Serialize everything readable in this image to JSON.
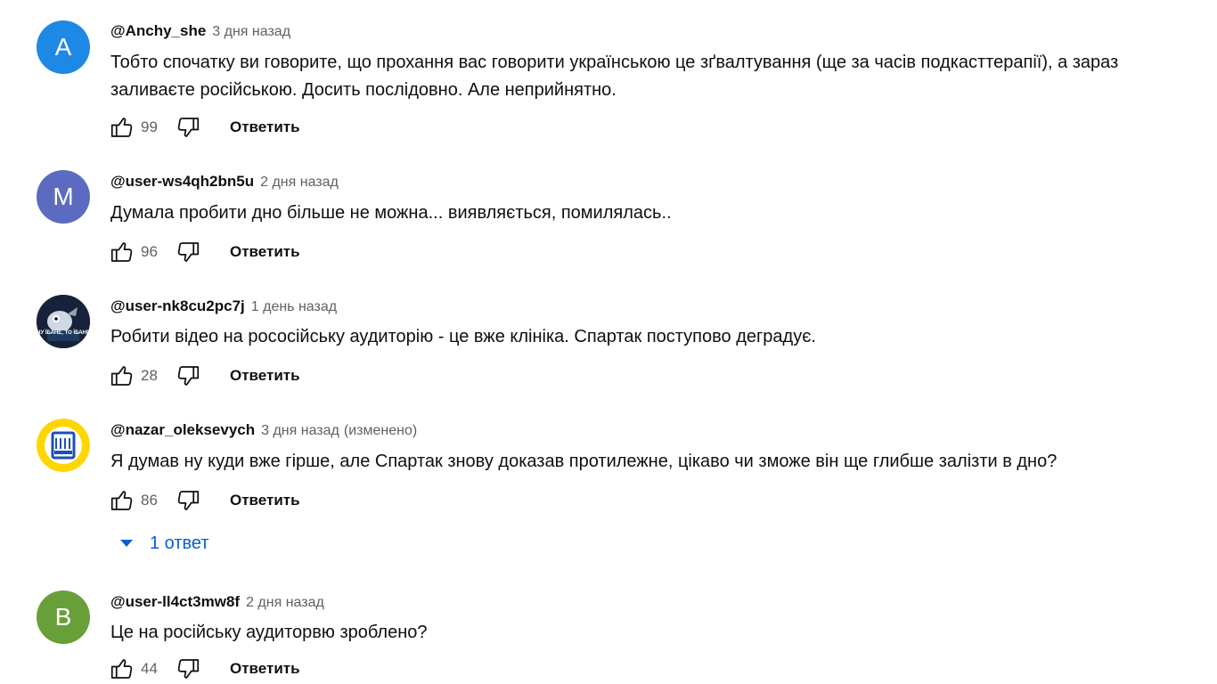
{
  "comments": [
    {
      "author": "@Anchy_she",
      "time": "3 дня назад",
      "edited": "",
      "avatar_letter": "A",
      "avatar_color": "#1e88e5",
      "text": "Тобто спочатку ви говорите, що прохання вас говорити українською це зґвалтування (ще за часів подкасттерапії), а зараз заливаєте російською. Досить послідовно. Але неприйнятно.",
      "likes": "99",
      "reply_label": "Ответить"
    },
    {
      "author": "@user-ws4qh2bn5u",
      "time": "2 дня назад",
      "edited": "",
      "avatar_letter": "M",
      "avatar_color": "#5c6bc0",
      "text": "Думала пробити дно більше не можна... виявляється, помилялась..",
      "likes": "96",
      "reply_label": "Ответить"
    },
    {
      "author": "@user-nk8cu2pc7j",
      "time": "1 день назад",
      "edited": "",
      "avatar_caption": "ну їбане, то їбане",
      "text": "Робити відео на рососійську аудиторію - це вже клініка. Спартак поступово деградує.",
      "likes": "28",
      "reply_label": "Ответить"
    },
    {
      "author": "@nazar_oleksevych",
      "time": "3 дня назад",
      "edited": "(изменено)",
      "text": "Я думав ну куди вже гірше, але Спартак знову доказав протилежне, цікаво чи зможе він ще глибше залізти в дно?",
      "likes": "86",
      "reply_label": "Ответить",
      "replies_label": "1 ответ"
    },
    {
      "author": "@user-ll4ct3mw8f",
      "time": "2 дня назад",
      "edited": "",
      "avatar_letter": "B",
      "avatar_color": "#689f38",
      "text": "Це на російську аудиторвю зроблено?",
      "likes": "44",
      "reply_label": "Ответить"
    }
  ],
  "icons": {
    "like": "thumb-up-icon",
    "dislike": "thumb-down-icon",
    "expand": "caret-down-icon"
  }
}
